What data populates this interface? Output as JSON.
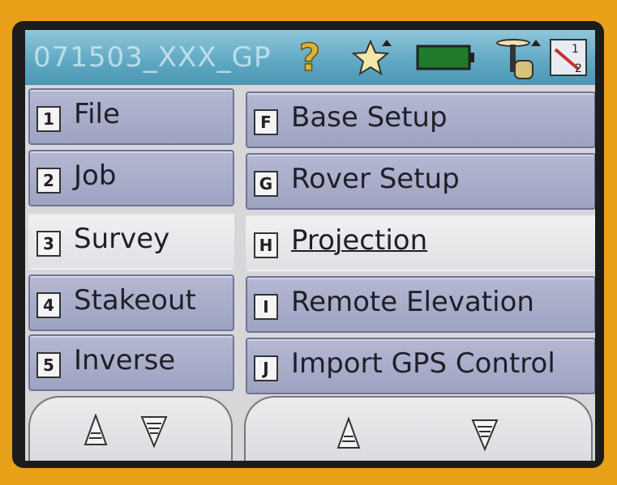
{
  "header": {
    "job_name": "071503_XXX_GP",
    "icons": [
      "help-icon",
      "favorites-star-icon",
      "battery-icon",
      "gps-antenna-icon",
      "switch-screen-icon"
    ]
  },
  "left_menu": [
    {
      "key": "1",
      "label": "File"
    },
    {
      "key": "2",
      "label": "Job"
    },
    {
      "key": "3",
      "label": "Survey",
      "selected": true
    },
    {
      "key": "4",
      "label": "Stakeout"
    },
    {
      "key": "5",
      "label": "Inverse"
    }
  ],
  "right_menu": [
    {
      "key": "F",
      "label": "Base Setup"
    },
    {
      "key": "G",
      "label": "Rover Setup"
    },
    {
      "key": "H",
      "label": "Projection",
      "underlined": true
    },
    {
      "key": "I",
      "label": "Remote Elevation"
    },
    {
      "key": "J",
      "label": "Import GPS Control"
    }
  ],
  "colors": {
    "case": "#e9a11a",
    "titlebar": "#5ea7c2",
    "button": "#a8acc8",
    "selected": "#efeff1",
    "help": "#d9b43a",
    "battery": "#1f7a2c"
  }
}
